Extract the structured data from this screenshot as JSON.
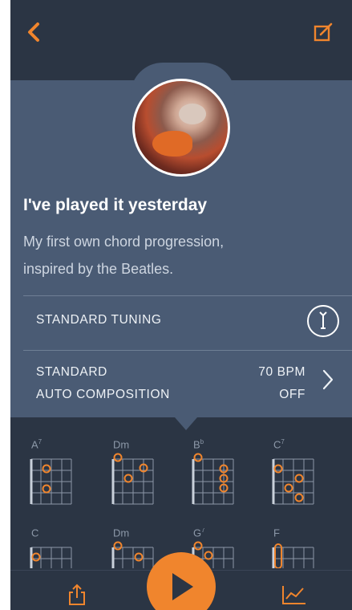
{
  "song": {
    "title": "I've played it yesterday",
    "description_line1": "My first own chord progression,",
    "description_line2": "inspired by the Beatles."
  },
  "settings": {
    "tuning_label": "STANDARD TUNING",
    "rhythm_label": "STANDARD",
    "bpm_value": "70 BPM",
    "auto_label": "AUTO COMPOSITION",
    "auto_value": "OFF"
  },
  "chords": {
    "row1": [
      {
        "name": "A",
        "sup": "7"
      },
      {
        "name": "Dm",
        "sup": ""
      },
      {
        "name": "B",
        "sup": "b"
      },
      {
        "name": "C",
        "sup": "7"
      }
    ],
    "row2": [
      {
        "name": "C",
        "sup": ""
      },
      {
        "name": "Dm",
        "sup": ""
      },
      {
        "name": "G",
        "sup": "7"
      },
      {
        "name": "F",
        "sup": ""
      }
    ]
  },
  "icons": {
    "back": "chevron-left-icon",
    "edit": "edit-icon",
    "tuning": "tuning-fork-icon",
    "share": "share-icon",
    "play": "play-icon",
    "stats": "chart-icon"
  },
  "colors": {
    "accent": "#f0852d",
    "background": "#2b3544",
    "card": "#4a5b74"
  }
}
